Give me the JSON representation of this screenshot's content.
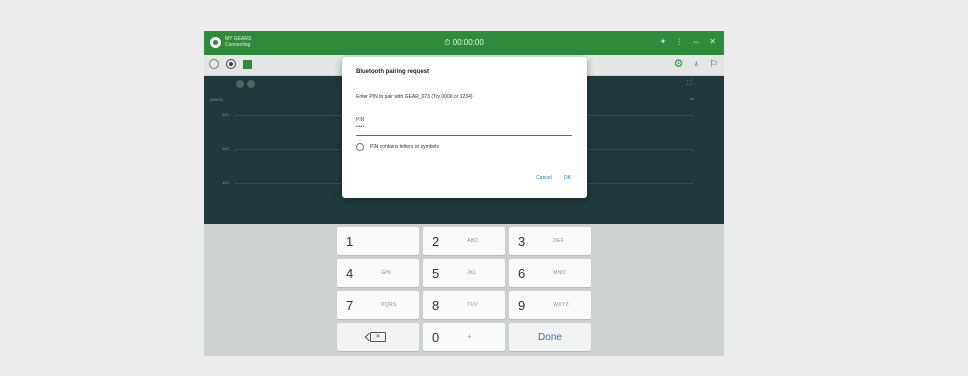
{
  "app": {
    "logo_text": "MY GEARS",
    "logo_sub": "Connecting",
    "timer": "⏱ 00:00:00",
    "bar_icons": [
      "✦",
      "⋮",
      "⇔",
      "✕"
    ]
  },
  "toolbar": {
    "right_icons": [
      "⚙",
      "♁",
      "⚐"
    ]
  },
  "chart": {
    "unit": "[W/KG]",
    "right_label": "n/l",
    "y_ticks": [
      "300",
      "200",
      "100"
    ]
  },
  "dialog": {
    "title": "Bluetooth pairing request",
    "message": "Enter PIN to pair with GEAR_073 (Try 0000 or 1234)",
    "pin_label": "PIN",
    "pin_value": "••••",
    "checkbox_label": "PIN contains letters or symbols",
    "cancel_label": "Cancel",
    "ok_label": "OK"
  },
  "keyboard": {
    "keys": [
      {
        "digit": "1",
        "letters": ""
      },
      {
        "digit": "2",
        "letters": "ABC"
      },
      {
        "digit": "3",
        "letters": "DEF"
      },
      {
        "digit": "4",
        "letters": "GHI"
      },
      {
        "digit": "5",
        "letters": "JKL"
      },
      {
        "digit": "6",
        "letters": "MNO"
      },
      {
        "digit": "7",
        "letters": "PQRS"
      },
      {
        "digit": "8",
        "letters": "TUV"
      },
      {
        "digit": "9",
        "letters": "WXYZ"
      }
    ],
    "backspace_glyph": "✕",
    "zero": "0",
    "plus": "+",
    "done_label": "Done"
  }
}
